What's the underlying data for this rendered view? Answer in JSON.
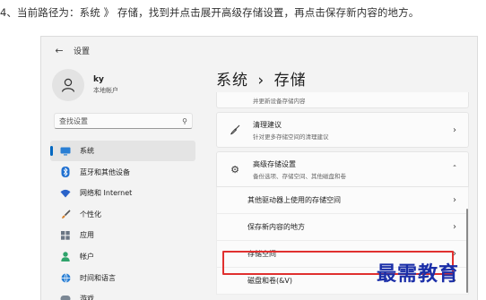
{
  "instruction": "4、当前路径为：系统 》 存储，找到并点击展开高级存储设置，再点击保存新内容的地方。",
  "window": {
    "back_icon": "back-arrow-icon",
    "title": "设置"
  },
  "profile": {
    "name": "ky",
    "type": "本地帐户"
  },
  "search": {
    "placeholder": "查找设置"
  },
  "nav": [
    {
      "label": "系统",
      "icon": "monitor-icon",
      "active": true
    },
    {
      "label": "蓝牙和其他设备",
      "icon": "bluetooth-icon"
    },
    {
      "label": "网络和 Internet",
      "icon": "wifi-icon"
    },
    {
      "label": "个性化",
      "icon": "brush-icon"
    },
    {
      "label": "应用",
      "icon": "apps-icon"
    },
    {
      "label": "帐户",
      "icon": "account-icon"
    },
    {
      "label": "时间和语言",
      "icon": "globe-icon"
    },
    {
      "label": "游戏",
      "icon": "gamepad-icon"
    }
  ],
  "breadcrumb": {
    "parent": "系统",
    "separator": "›",
    "current": "存储"
  },
  "cards": {
    "top_partial_sub": "并更新设备存储内容",
    "cleanup": {
      "title": "清理建议",
      "subtitle": "针对更多存储空间的清理建议"
    },
    "advanced": {
      "title": "高级存储设置",
      "subtitle": "备份选项、存储空间、其他磁盘和卷"
    },
    "sub_items": [
      {
        "label": "其他驱动器上使用的存储空间"
      },
      {
        "label": "保存新内容的地方"
      },
      {
        "label": "存储空间"
      },
      {
        "label": "磁盘和卷(&V)"
      }
    ]
  },
  "watermark": "最需教育",
  "colors": {
    "accent": "#0067c0",
    "highlight": "#e0302f",
    "watermark": "#1a2ea8"
  }
}
